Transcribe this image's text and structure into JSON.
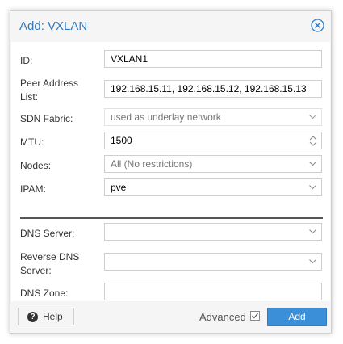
{
  "dialog": {
    "title": "Add: VXLAN",
    "close_icon": "close-circle-icon"
  },
  "fields": {
    "id": {
      "label": "ID:",
      "value": "VXLAN1"
    },
    "peers": {
      "label_line1": "Peer Address",
      "label_line2": "List:",
      "value": "192.168.15.11, 192.168.15.12, 192.168.15.13"
    },
    "fabric": {
      "label": "SDN Fabric:",
      "value": "used as underlay network"
    },
    "mtu": {
      "label": "MTU:",
      "value": "1500"
    },
    "nodes": {
      "label": "Nodes:",
      "value": "All (No restrictions)"
    },
    "ipam": {
      "label": "IPAM:",
      "value": "pve"
    },
    "dns_server": {
      "label": "DNS Server:",
      "value": ""
    },
    "reverse_dns": {
      "label_line1": "Reverse DNS",
      "label_line2": "Server:",
      "value": ""
    },
    "dns_zone": {
      "label": "DNS Zone:",
      "value": ""
    }
  },
  "footer": {
    "help_label": "Help",
    "advanced_label": "Advanced",
    "advanced_checked": true,
    "add_label": "Add"
  },
  "colors": {
    "accent": "#3079bf",
    "primary_button": "#3b8fd9"
  }
}
